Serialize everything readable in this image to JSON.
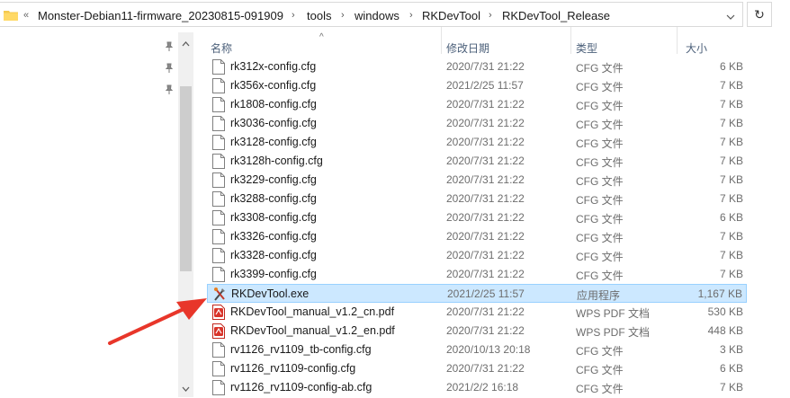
{
  "window": {
    "address": {
      "overflow": "«",
      "crumbs": [
        "Monster-Debian11-firmware_20230815-091909",
        "tools",
        "windows",
        "RKDevTool",
        "RKDevTool_Release"
      ],
      "refresh_icon": "↻"
    }
  },
  "columns": {
    "name": "名称",
    "date": "修改日期",
    "type": "类型",
    "size": "大小"
  },
  "files": [
    {
      "name": "rk312x-config.cfg",
      "date": "2020/7/31 21:22",
      "type": "CFG 文件",
      "size": "6 KB",
      "icon": "file-icon"
    },
    {
      "name": "rk356x-config.cfg",
      "date": "2021/2/25 11:57",
      "type": "CFG 文件",
      "size": "7 KB",
      "icon": "file-icon"
    },
    {
      "name": "rk1808-config.cfg",
      "date": "2020/7/31 21:22",
      "type": "CFG 文件",
      "size": "7 KB",
      "icon": "file-icon"
    },
    {
      "name": "rk3036-config.cfg",
      "date": "2020/7/31 21:22",
      "type": "CFG 文件",
      "size": "7 KB",
      "icon": "file-icon"
    },
    {
      "name": "rk3128-config.cfg",
      "date": "2020/7/31 21:22",
      "type": "CFG 文件",
      "size": "7 KB",
      "icon": "file-icon"
    },
    {
      "name": "rk3128h-config.cfg",
      "date": "2020/7/31 21:22",
      "type": "CFG 文件",
      "size": "7 KB",
      "icon": "file-icon"
    },
    {
      "name": "rk3229-config.cfg",
      "date": "2020/7/31 21:22",
      "type": "CFG 文件",
      "size": "7 KB",
      "icon": "file-icon"
    },
    {
      "name": "rk3288-config.cfg",
      "date": "2020/7/31 21:22",
      "type": "CFG 文件",
      "size": "7 KB",
      "icon": "file-icon"
    },
    {
      "name": "rk3308-config.cfg",
      "date": "2020/7/31 21:22",
      "type": "CFG 文件",
      "size": "6 KB",
      "icon": "file-icon"
    },
    {
      "name": "rk3326-config.cfg",
      "date": "2020/7/31 21:22",
      "type": "CFG 文件",
      "size": "7 KB",
      "icon": "file-icon"
    },
    {
      "name": "rk3328-config.cfg",
      "date": "2020/7/31 21:22",
      "type": "CFG 文件",
      "size": "7 KB",
      "icon": "file-icon"
    },
    {
      "name": "rk3399-config.cfg",
      "date": "2020/7/31 21:22",
      "type": "CFG 文件",
      "size": "7 KB",
      "icon": "file-icon"
    },
    {
      "name": "RKDevTool.exe",
      "date": "2021/2/25 11:57",
      "type": "应用程序",
      "size": "1,167 KB",
      "icon": "tools-icon",
      "selected": true
    },
    {
      "name": "RKDevTool_manual_v1.2_cn.pdf",
      "date": "2020/7/31 21:22",
      "type": "WPS PDF 文档",
      "size": "530 KB",
      "icon": "pdf-icon"
    },
    {
      "name": "RKDevTool_manual_v1.2_en.pdf",
      "date": "2020/7/31 21:22",
      "type": "WPS PDF 文档",
      "size": "448 KB",
      "icon": "pdf-icon"
    },
    {
      "name": "rv1126_rv1109_tb-config.cfg",
      "date": "2020/10/13 20:18",
      "type": "CFG 文件",
      "size": "3 KB",
      "icon": "file-icon"
    },
    {
      "name": "rv1126_rv1109-config.cfg",
      "date": "2020/7/31 21:22",
      "type": "CFG 文件",
      "size": "6 KB",
      "icon": "file-icon"
    },
    {
      "name": "rv1126_rv1109-config-ab.cfg",
      "date": "2021/2/2 16:18",
      "type": "CFG 文件",
      "size": "7 KB",
      "icon": "file-icon"
    }
  ],
  "colors": {
    "selection": "#cce8ff",
    "selection_border": "#99d1ff",
    "header_text": "#4c607a",
    "annotation_arrow": "#e8362a"
  }
}
